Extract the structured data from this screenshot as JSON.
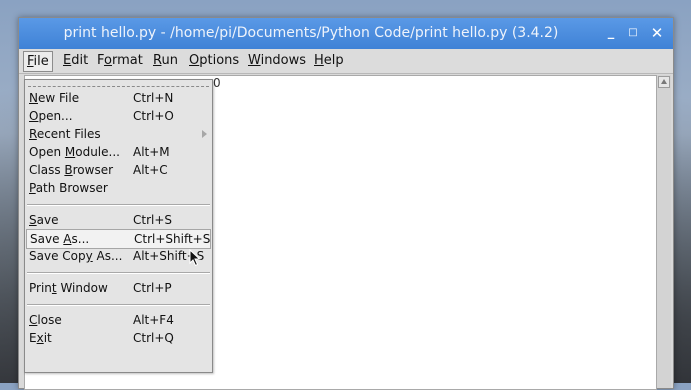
{
  "window": {
    "title": "print hello.py - /home/pi/Documents/Python Code/print hello.py (3.4.2)",
    "controls": {
      "minimize": "_",
      "maximize": "□",
      "close": "✕"
    }
  },
  "menubar": [
    {
      "pre": "",
      "u": "F",
      "post": "ile"
    },
    {
      "pre": "",
      "u": "E",
      "post": "dit"
    },
    {
      "pre": "F",
      "u": "o",
      "post": "rmat"
    },
    {
      "pre": "",
      "u": "R",
      "post": "un"
    },
    {
      "pre": "",
      "u": "O",
      "post": "ptions"
    },
    {
      "pre": "",
      "u": "W",
      "post": "indows"
    },
    {
      "pre": "",
      "u": "H",
      "post": "elp"
    }
  ],
  "file_menu": {
    "new_file": {
      "pre": "",
      "u": "N",
      "post": "ew File",
      "accel": "Ctrl+N"
    },
    "open": {
      "pre": "",
      "u": "O",
      "post": "pen...",
      "accel": "Ctrl+O"
    },
    "recent_files": {
      "pre": "",
      "u": "R",
      "post": "ecent Files",
      "accel": ""
    },
    "open_module": {
      "pre": "Open ",
      "u": "M",
      "post": "odule...",
      "accel": "Alt+M"
    },
    "class_browser": {
      "pre": "Class ",
      "u": "B",
      "post": "rowser",
      "accel": "Alt+C"
    },
    "path_browser": {
      "pre": "",
      "u": "P",
      "post": "ath Browser",
      "accel": ""
    },
    "save": {
      "pre": "",
      "u": "S",
      "post": "ave",
      "accel": "Ctrl+S"
    },
    "save_as": {
      "pre": "Save ",
      "u": "A",
      "post": "s...",
      "accel": "Ctrl+Shift+S"
    },
    "save_copy_as": {
      "pre": "Save Cop",
      "u": "y",
      "post": " As...",
      "accel": "Alt+Shift+S"
    },
    "print_window": {
      "pre": "Prin",
      "u": "t",
      "post": " Window",
      "accel": "Ctrl+P"
    },
    "close": {
      "pre": "",
      "u": "C",
      "post": "lose",
      "accel": "Alt+F4"
    },
    "exit": {
      "pre": "E",
      "u": "x",
      "post": "it",
      "accel": "Ctrl+Q"
    }
  },
  "editor": {
    "visible_text": "0"
  },
  "colors": {
    "titlebar": "#3f82d6",
    "menu_bg": "#e4e4e4",
    "editor_bg": "#ffffff"
  }
}
